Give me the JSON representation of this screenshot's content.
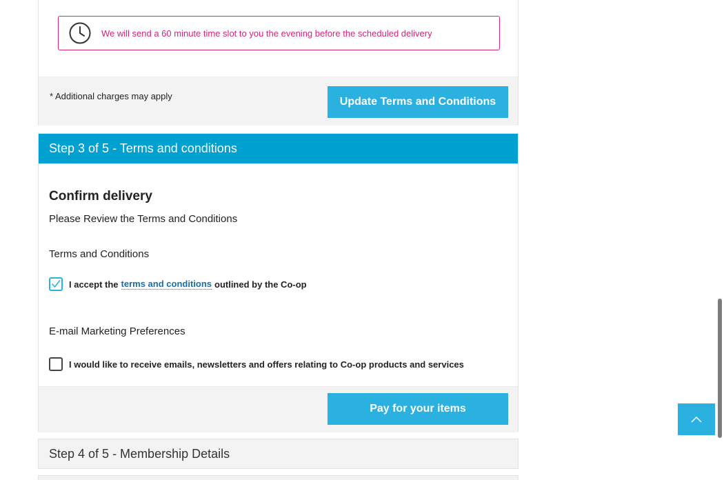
{
  "delivery_notice": {
    "icon": "clock-icon",
    "text": "We will send a 60 minute time slot to you the evening before the scheduled delivery",
    "color": "#d6247a"
  },
  "step2_footer": {
    "additional_charges": "* Additional charges may apply",
    "update_button": "Update Terms and Conditions"
  },
  "step3": {
    "header": "Step 3 of 5 - Terms and conditions",
    "confirm_title": "Confirm delivery",
    "review_text": "Please Review the Terms and Conditions",
    "terms_label": "Terms and Conditions",
    "accept": {
      "checked": true,
      "prefix": "I accept the",
      "link": "terms and conditions",
      "suffix": "outlined by the Co-op"
    },
    "email_label": "E-mail Marketing Preferences",
    "email_optin": {
      "checked": false,
      "text": "I would like to receive emails, newsletters and offers relating to Co-op products and services"
    },
    "pay_button": "Pay for your items"
  },
  "step4": {
    "header": "Step 4 of 5 - Membership Details"
  },
  "colors": {
    "header_blue": "#00a0d0",
    "button_blue": "#2bb1e0",
    "link_blue": "#1a6fa8"
  },
  "scroll_top_icon": "chevron-up-icon"
}
